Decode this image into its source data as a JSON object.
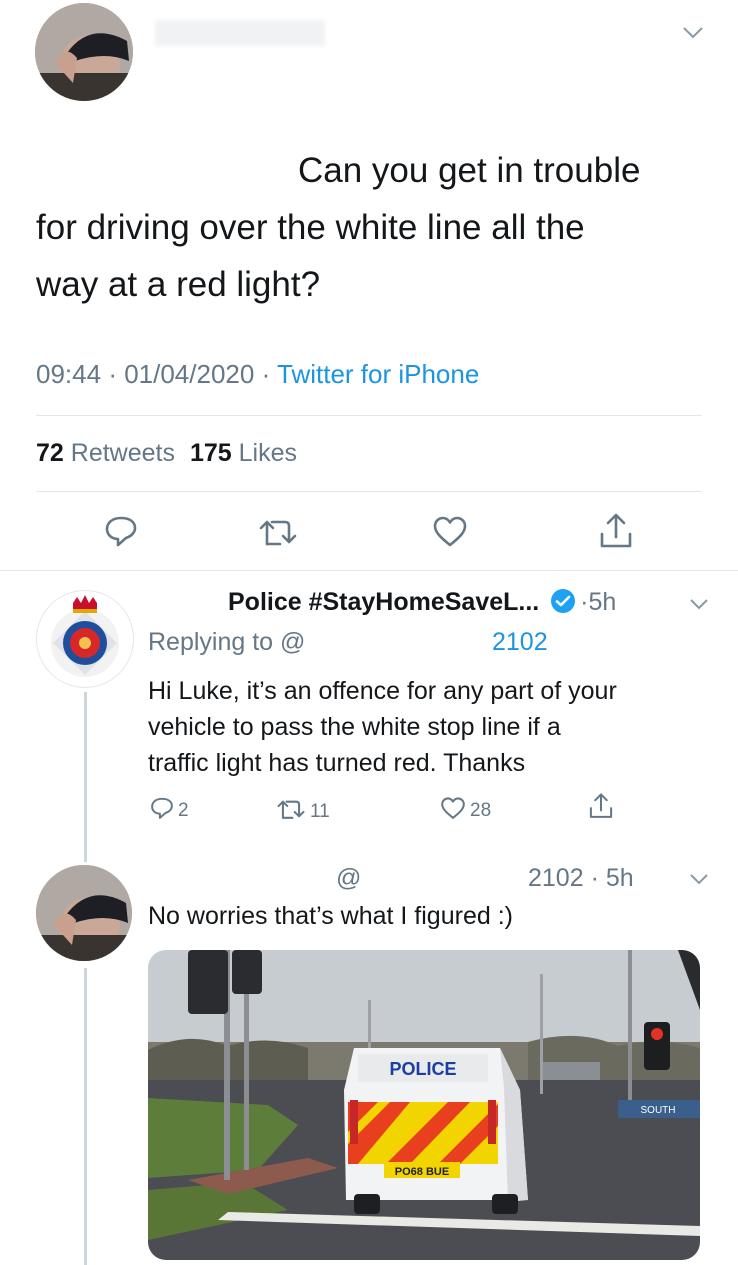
{
  "main_tweet": {
    "text_line1": "Can you get in trouble",
    "text_line2": "for driving over the white line all the",
    "text_line3": "way at a red light?",
    "time": "09:44",
    "date": "01/04/2020",
    "source": "Twitter for iPhone",
    "retweets_count": "72",
    "retweets_label": "Retweets",
    "likes_count": "175",
    "likes_label": "Likes"
  },
  "reply1": {
    "author": "Police #StayHomeSaveL...",
    "time": "5h",
    "replying_prefix": "Replying to @",
    "replying_handle_end": "2102",
    "text_line1": "Hi Luke, it’s an offence for any part of your",
    "text_line2": "vehicle to pass the white stop line if a",
    "text_line3": "traffic light has turned red. Thanks",
    "replies": "2",
    "retweets": "11",
    "likes": "28"
  },
  "reply2": {
    "handle_at": "@",
    "handle_end": "2102",
    "time": "5h",
    "text": "No worries that’s what I figured :)",
    "image_van_text": "POLICE",
    "image_plate": "PO68 BUE",
    "image_sign": "SOUTH"
  },
  "colors": {
    "link": "#1b95e0",
    "secondary": "#657786",
    "divider": "#e1e8ed",
    "verified": "#1da1f2"
  },
  "icons": [
    "chevron-down-icon",
    "reply-icon",
    "retweet-icon",
    "like-icon",
    "share-icon",
    "verified-badge-icon"
  ]
}
